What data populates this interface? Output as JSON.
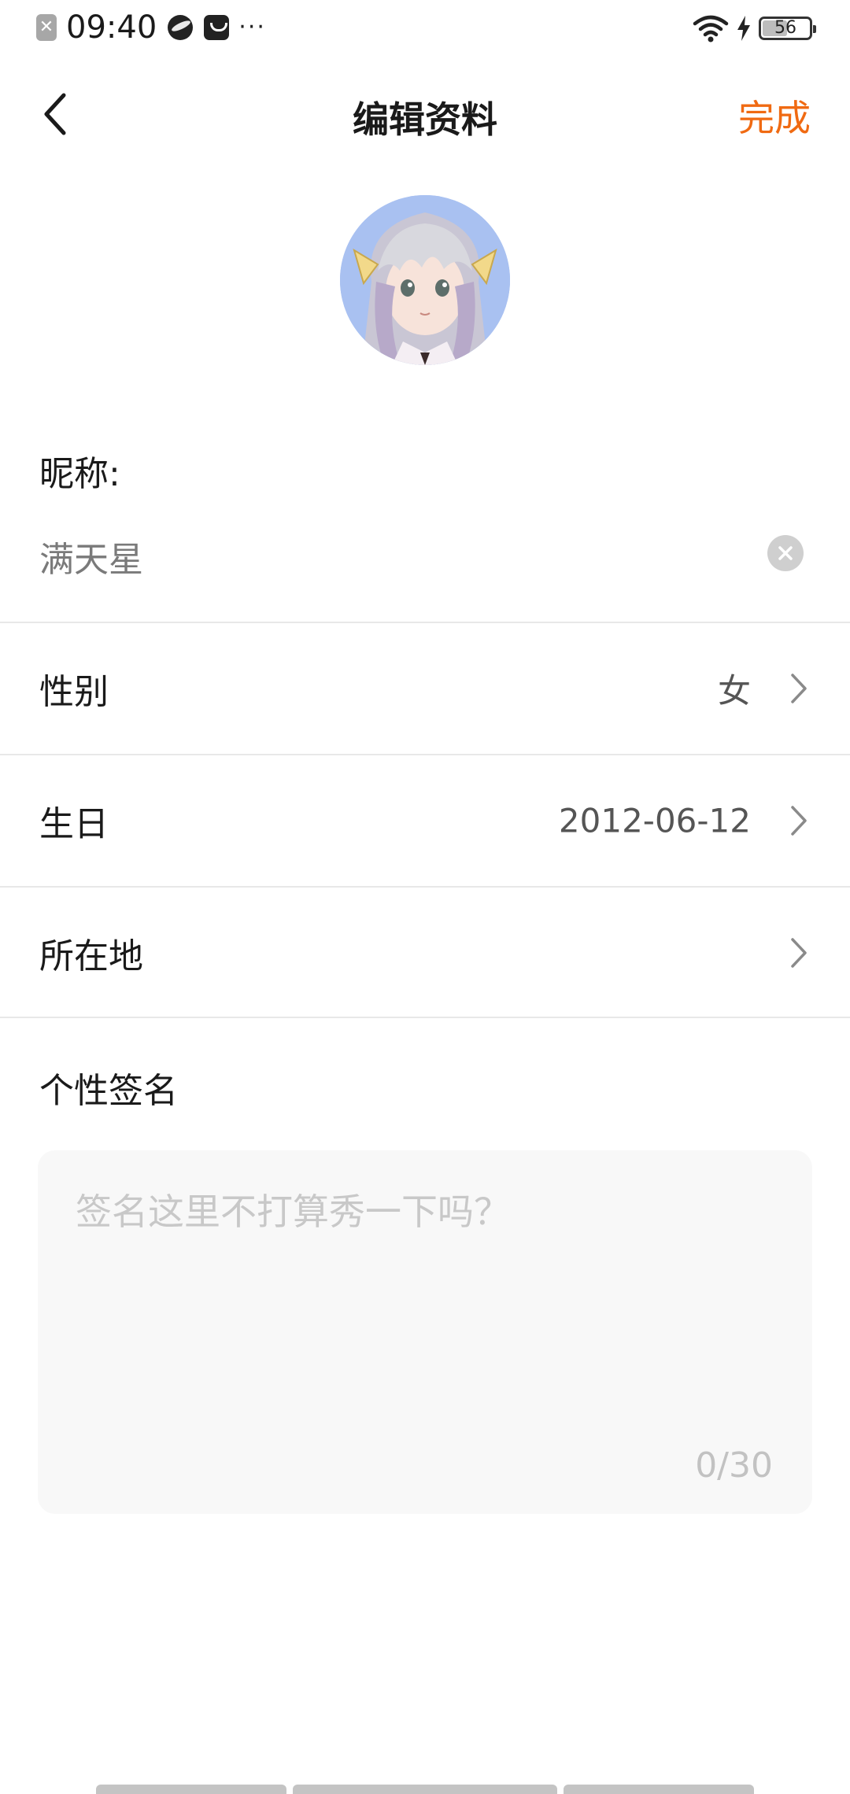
{
  "status_bar": {
    "sim_glyph": "✕",
    "time": "09:40",
    "more_dots": "···",
    "battery_level": "56",
    "battery_fraction": 0.56,
    "icons": [
      "sim-icon",
      "app-notification-icon",
      "message-icon",
      "wifi-icon",
      "charging-icon",
      "battery-icon"
    ]
  },
  "nav": {
    "title": "编辑资料",
    "done_label": "完成",
    "accent_color": "#f06a12"
  },
  "profile": {
    "nickname_label": "昵称:",
    "nickname_value": "满天星",
    "rows": [
      {
        "label": "性别",
        "value": "女"
      },
      {
        "label": "生日",
        "value": "2012-06-12"
      },
      {
        "label": "所在地",
        "value": ""
      }
    ],
    "signature_label": "个性签名",
    "signature_placeholder": "签名这里不打算秀一下吗？",
    "signature_value": "",
    "signature_counter": "0/30"
  }
}
